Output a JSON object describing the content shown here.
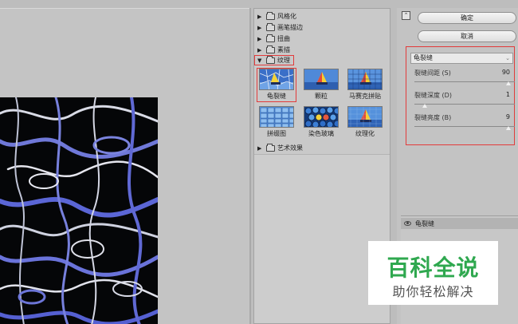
{
  "gallery": {
    "categories": [
      {
        "label": "风格化",
        "expanded": false
      },
      {
        "label": "画笔描边",
        "expanded": false
      },
      {
        "label": "扭曲",
        "expanded": false
      },
      {
        "label": "素描",
        "expanded": false
      },
      {
        "label": "纹理",
        "expanded": true
      },
      {
        "label": "艺术效果",
        "expanded": false
      }
    ],
    "texture_filters": [
      {
        "label": "龟裂缝",
        "selected": true
      },
      {
        "label": "颗粒",
        "selected": false
      },
      {
        "label": "马赛克拼贴",
        "selected": false
      },
      {
        "label": "拼缀图",
        "selected": false
      },
      {
        "label": "染色玻璃",
        "selected": false
      },
      {
        "label": "纹理化",
        "selected": false
      }
    ]
  },
  "panel": {
    "collapse_icon": "collapse-icon",
    "ok_label": "确定",
    "cancel_label": "取消",
    "filter_select": "龟裂缝",
    "params": [
      {
        "label": "裂缝间距 (S)",
        "value": "90",
        "fraction": 0.94
      },
      {
        "label": "裂缝深度 (D)",
        "value": "1",
        "fraction": 0.1
      },
      {
        "label": "裂缝亮度 (B)",
        "value": "9",
        "fraction": 0.94
      }
    ],
    "layer_name": "龟裂缝"
  },
  "watermark": {
    "title": "百科全说",
    "subtitle": "助你轻松解决"
  },
  "colors": {
    "highlight": "#e23b3b",
    "watermark_green": "#2fa84f"
  }
}
